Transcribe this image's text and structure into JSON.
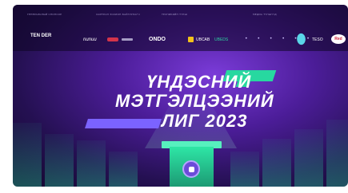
{
  "banner": {
    "sponsors": {
      "label_1": "ГЕНЕРАЛЬНЫЙ СПОНСОР",
      "label_2": "ХАМТРАН ЗОХИОН БАЙГУУЛАГЧ",
      "label_3": "ТЕХНИКИЙН ТҮНШ",
      "label_4": "МЕДИА ТҮНШҮҮД",
      "logo_1": "TEN DER",
      "logo_2": "nunuu",
      "logo_3": "ONDO",
      "logo_4": "UBCAB",
      "logo_5": "UBEDS",
      "logo_6": "TESO",
      "logo_7": "Red",
      "dots": "• • • • • •"
    },
    "title_line_1": "ҮНДЭСНИЙ",
    "title_line_2": "МЭТГЭЛЦЭЭНИЙ",
    "title_line_3": "ЛИГ 2023"
  },
  "colors": {
    "accent_green": "#27d8a0",
    "accent_purple": "#7b63ff",
    "background": "#3a1780"
  }
}
